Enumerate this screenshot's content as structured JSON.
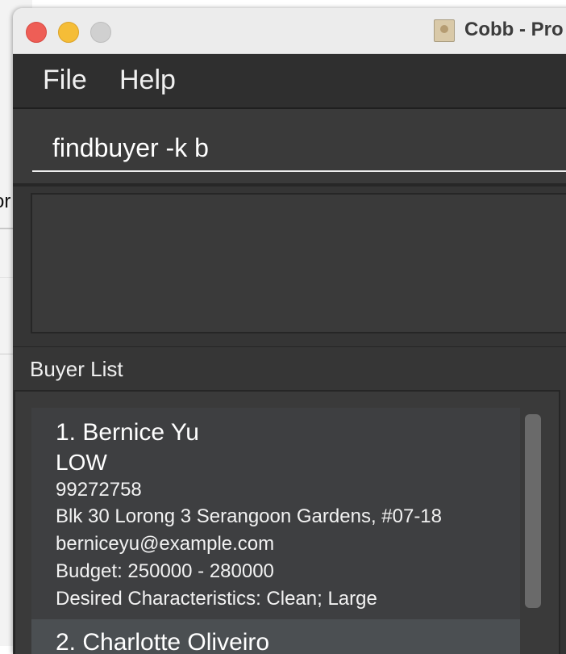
{
  "window": {
    "title": "Cobb - Pro"
  },
  "background_window": {
    "partial_text": "or"
  },
  "menu": {
    "file": "File",
    "help": "Help"
  },
  "command": {
    "value": "findbuyer -k b"
  },
  "result": {
    "text": ""
  },
  "buyer_list": {
    "header": "Buyer List",
    "buyers": [
      {
        "title": "1.  Bernice Yu",
        "priority": "LOW",
        "phone": "99272758",
        "address": "Blk 30 Lorong 3 Serangoon Gardens, #07-18",
        "email": "berniceyu@example.com",
        "budget": "Budget: 250000 - 280000",
        "characteristics": "Desired Characteristics: Clean; Large"
      },
      {
        "title": "2.  Charlotte Oliveiro"
      }
    ]
  },
  "colors": {
    "titlebar": "#ececec",
    "menubar": "#2f2f2f",
    "panel_dark": "#3a3a3a",
    "card": "#3e3f41",
    "card_selected": "#4b4f52",
    "close": "#ee5e56",
    "minimize": "#f5bd37",
    "maximize": "#d0d0d0"
  },
  "icons": {
    "app": "address-book-icon"
  }
}
